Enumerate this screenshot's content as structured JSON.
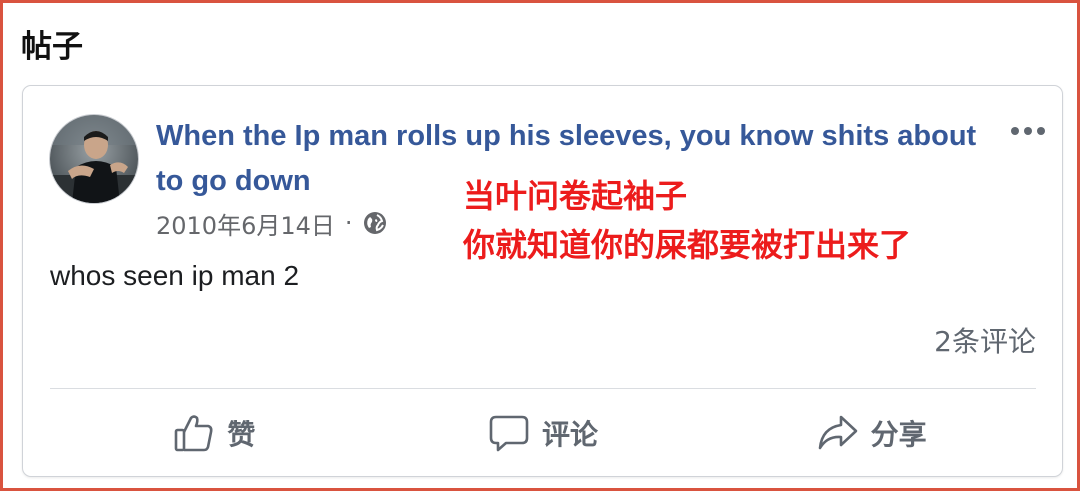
{
  "section": {
    "title": "帖子"
  },
  "post": {
    "title": "When the Ip man rolls up his sleeves, you know shits about to go down",
    "date": "2010年6月14日",
    "separator": "·",
    "body": "whos seen ip man 2",
    "comments_count": "2条评论",
    "icons": {
      "privacy": "globe-icon",
      "more": "more-options-icon"
    }
  },
  "overlay": {
    "line1": "当叶问卷起袖子",
    "line2": "你就知道你的屎都要被打出来了",
    "color": "#ec1c1c"
  },
  "actions": {
    "like": {
      "label": "赞",
      "icon": "thumbs-up-icon"
    },
    "comment": {
      "label": "评论",
      "icon": "speech-bubble-icon"
    },
    "share": {
      "label": "分享",
      "icon": "share-arrow-icon"
    }
  },
  "colors": {
    "frame_border": "#d9533f",
    "title_link": "#365899",
    "secondary_text": "#65676b"
  }
}
